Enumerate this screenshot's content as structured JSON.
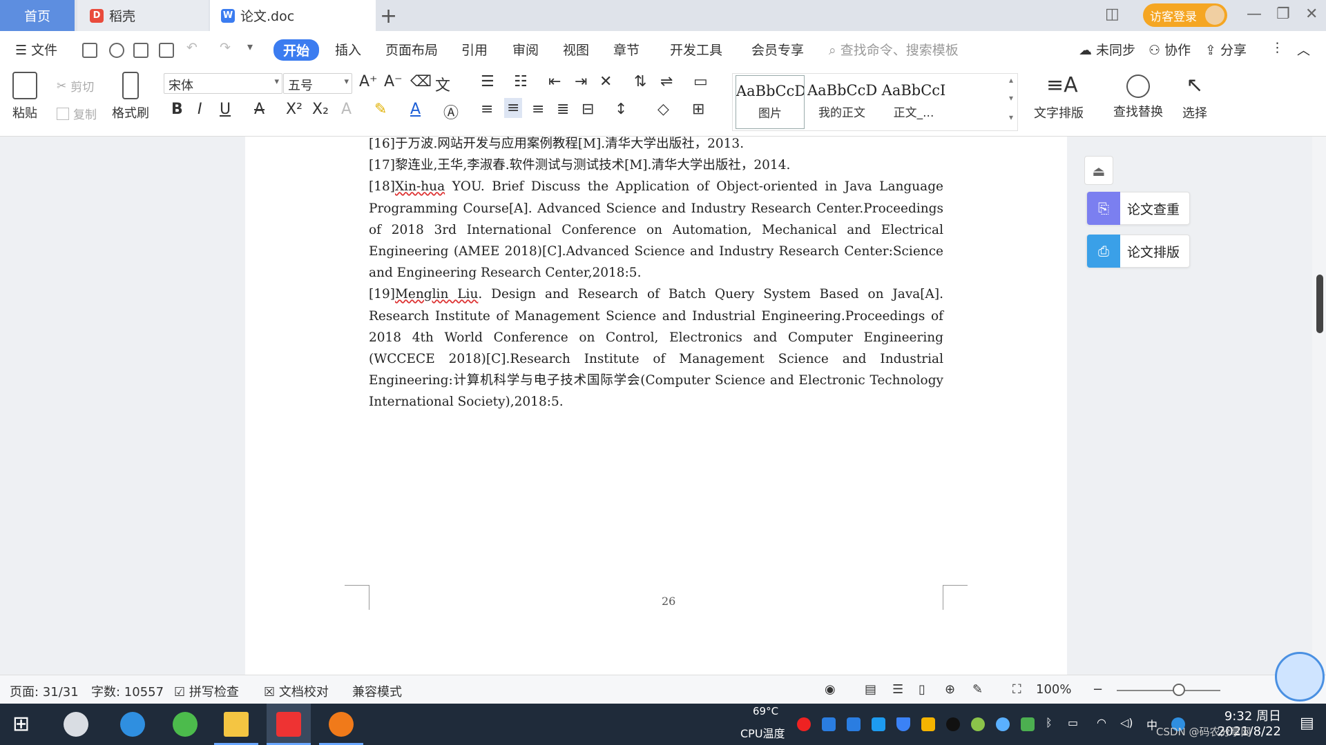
{
  "titlebar": {
    "tabs": [
      {
        "label": "首页"
      },
      {
        "label": "稻壳"
      },
      {
        "label": "论文.doc"
      }
    ],
    "login_label": "访客登录"
  },
  "menubar": {
    "file_label": "文件",
    "items": [
      "开始",
      "插入",
      "页面布局",
      "引用",
      "审阅",
      "视图",
      "章节",
      "开发工具",
      "会员专享"
    ],
    "search_placeholder": "查找命令、搜索模板",
    "sync_label": "未同步",
    "collab_label": "协作",
    "share_label": "分享"
  },
  "ribbon": {
    "paste_label": "粘贴",
    "cut_label": "剪切",
    "copy_label": "复制",
    "format_painter_label": "格式刷",
    "font_name": "宋体",
    "font_size": "五号",
    "styles": [
      {
        "sample": "AaBbCcDd",
        "caption": "图片"
      },
      {
        "sample": "AaBbCcDd",
        "caption": "我的正文"
      },
      {
        "sample": "AaBbCcI",
        "caption": "正文_..."
      }
    ],
    "text_layout_label": "文字排版",
    "find_replace_label": "查找替换",
    "select_label": "选择"
  },
  "document": {
    "ref16": "[16]于万波.网站开发与应用案例教程[M].清华大学出版社，2013.",
    "ref17": "[17]黎连业,王华,李淑春.软件测试与测试技术[M].清华大学出版社，2014.",
    "ref18_prefix": "[18]",
    "ref18_author": "Xin-hua",
    "ref18_rest": " YOU. Brief Discuss the Application of Object-oriented in Java Language Programming Course[A]. Advanced Science and Industry Research Center.Proceedings of 2018 3rd International Conference on Automation, Mechanical and Electrical Engineering (AMEE 2018)[C].Advanced Science and Industry Research Center:Science and Engineering Research Center,2018:5.",
    "ref19_prefix": "[19]",
    "ref19_author": "Menglin Liu",
    "ref19_rest": ". Design and Research of Batch Query System Based on Java[A]. Research Institute of Management Science and Industrial Engineering.Proceedings of 2018 4th World Conference on Control, Electronics and Computer Engineering (WCCECE 2018)[C].Research Institute of Management Science and Industrial Engineering:计算机科学与电子技术国际学会(Computer Science and Electronic Technology International Society),2018:5.",
    "page_number": "26"
  },
  "sidepanel": {
    "check_label": "论文查重",
    "layout_label": "论文排版"
  },
  "statusbar": {
    "page_label": "页面: 31/31",
    "words_label": "字数: 10557",
    "spell_label": "拼写检查",
    "proof_label": "文档校对",
    "compat_label": "兼容模式",
    "zoom_label": "100%",
    "zoom_level": 0.6
  },
  "taskbar": {
    "cpu_temp": "69°C",
    "cpu_label": "CPU温度",
    "ime_label": "中",
    "time": "9:32 周日",
    "date": "2021/8/22",
    "watermark": "CSDN @码农分享网"
  },
  "colors": {
    "accent": "#3b7cf0",
    "home_tab": "#5d8ee0",
    "login": "#f5a623",
    "check_btn": "#7b7ff0",
    "layout_btn": "#3aa0e8"
  }
}
